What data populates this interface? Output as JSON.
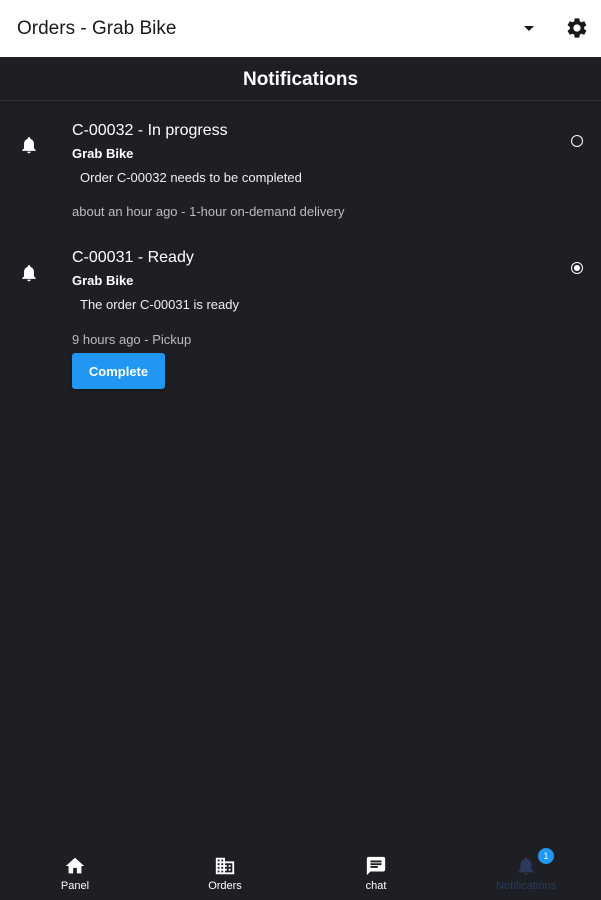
{
  "app_bar": {
    "title": "Orders - Grab Bike",
    "dropdown_icon": "caret-down-icon",
    "settings_icon": "gear-icon"
  },
  "header": {
    "title": "Notifications"
  },
  "notifications": [
    {
      "icon": "bell-icon",
      "title": "C-00032 - In progress",
      "source": "Grab Bike",
      "message": "Order C-00032 needs to be completed",
      "meta": "about an hour ago - 1-hour on-demand delivery",
      "selected": false
    },
    {
      "icon": "bell-icon",
      "title": "C-00031 - Ready",
      "source": "Grab Bike",
      "message": "The order C-00031 is ready",
      "meta": "9 hours ago - Pickup",
      "selected": true,
      "action_label": "Complete"
    }
  ],
  "bottom_nav": {
    "items": [
      {
        "label": "Panel",
        "icon": "home-icon",
        "active": false
      },
      {
        "label": "Orders",
        "icon": "building-icon",
        "active": false
      },
      {
        "label": "chat",
        "icon": "chat-icon",
        "active": false
      },
      {
        "label": "Notifications",
        "icon": "bell-icon",
        "active": true
      }
    ],
    "notification_badge": "1"
  },
  "colors": {
    "background": "#1d1f24",
    "app_bar": "#ffffff",
    "accent": "#2196f3",
    "active_nav_label": "#2b3a5c",
    "meta_text": "#b9bcc2"
  }
}
